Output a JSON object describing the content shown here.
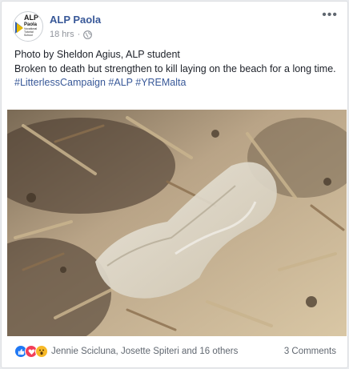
{
  "post": {
    "page_name": "ALP Paola",
    "time": "18 hrs",
    "separator": "·",
    "more": "•••",
    "logo": {
      "line1": "ALP",
      "line2": "Paola",
      "line3": "Vocational Tutorial School"
    },
    "text_lines": [
      "Photo by Sheldon Agius, ALP student",
      "Broken to death but strengthen to kill laying on the beach for a long time."
    ],
    "hashtags": "#LitterlessCampaign #ALP #YREMalta"
  },
  "footer": {
    "reaction_icons": [
      "like-icon",
      "love-icon",
      "wow-icon"
    ],
    "reactors": "Jennie Scicluna, Josette Spiteri and 16 others",
    "comments": "3 Comments"
  },
  "colors": {
    "link": "#385898",
    "like": "#2078f4",
    "love": "#f33e58",
    "wow": "#f7b928"
  }
}
